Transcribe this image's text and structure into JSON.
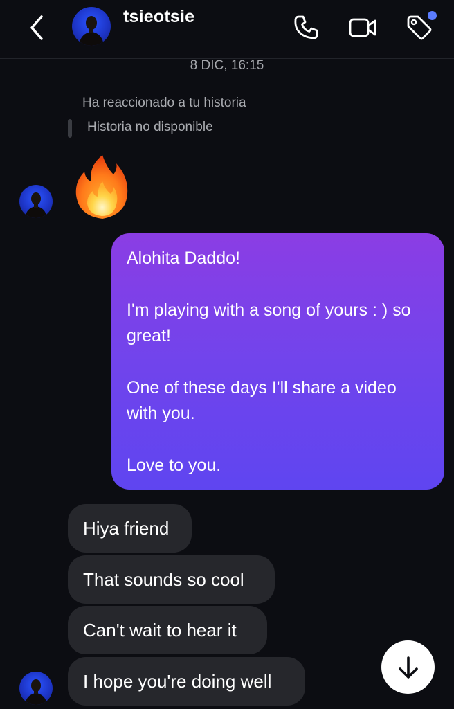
{
  "header": {
    "username": "tsieotsie",
    "back_icon": "chevron-left-icon",
    "phone_icon": "phone-icon",
    "video_icon": "video-camera-icon",
    "tag_icon": "tag-icon",
    "notification_dot_color": "#5b7cff"
  },
  "conversation": {
    "timestamp": "8 DIC, 16:15",
    "story_reaction": {
      "label": "Ha reaccionado a tu historia",
      "story_status": "Historia no disponible",
      "reaction_icon": "fire-emoji"
    },
    "sent_message": {
      "paragraphs": [
        "Alohita Daddo!",
        "I'm playing with a song of yours : ) so great!",
        "One of these days I'll share a video with you.",
        "Love to you."
      ]
    },
    "received_messages": [
      "Hiya friend",
      "That sounds so cool",
      "Can't wait to hear it",
      "I hope you're doing well"
    ]
  },
  "colors": {
    "background": "#0c0d12",
    "sent_bubble_top": "#8b3de4",
    "sent_bubble_bottom": "#5f45f0",
    "received_bubble": "#26272c"
  },
  "scroll_button_icon": "arrow-down-icon"
}
